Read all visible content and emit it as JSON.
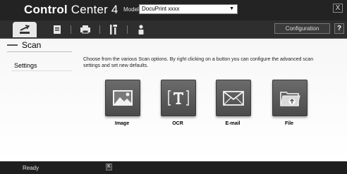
{
  "app": {
    "title_bold": "Control",
    "title_rest": " Center 4",
    "model_label": "Model",
    "model_value": "DocuPrint xxxx",
    "close_label": "X"
  },
  "tabs": [
    {
      "name": "scan",
      "icon": "scan-icon",
      "active": true
    },
    {
      "name": "pc-fax",
      "icon": "document-icon",
      "active": false
    },
    {
      "name": "device",
      "icon": "printer-icon",
      "active": false
    },
    {
      "name": "device-settings",
      "icon": "tools-icon",
      "active": false
    },
    {
      "name": "support",
      "icon": "person-icon",
      "active": false
    }
  ],
  "toolbar": {
    "configuration_label": "Configuration",
    "help_label": "?"
  },
  "section": {
    "title": "Scan",
    "settings_label": "Settings",
    "description": "Choose from the various Scan options. By right clicking on a button you can configure the advanced scan settings and set new defaults."
  },
  "scan_buttons": [
    {
      "label": "Image",
      "icon": "image-icon"
    },
    {
      "label": "OCR",
      "icon": "ocr-icon"
    },
    {
      "label": "E-mail",
      "icon": "envelope-icon"
    },
    {
      "label": "File",
      "icon": "folder-icon"
    }
  ],
  "status": {
    "text": "Ready",
    "icon_label": "K"
  },
  "colors": {
    "titlebar": "#232323",
    "button_face": "#5a5a5a",
    "statusbar": "#1e1e1e"
  }
}
